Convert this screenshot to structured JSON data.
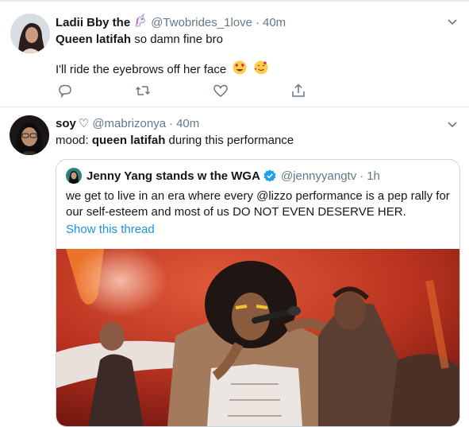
{
  "tweet1": {
    "display_name": "Ladii Bby the",
    "name_emoji": "unicorn-emoji",
    "handle": "@Twobrides_1love",
    "time": "40m",
    "line1_bold": "Queen latifah",
    "line1_rest": " so damn fine bro",
    "line2": "I'll ride the eyebrows off her face",
    "emojis": [
      "heart-eyes-emoji",
      "smiling-face-with-hearts-emoji"
    ],
    "actions": [
      "reply-icon",
      "retweet-icon",
      "like-icon",
      "share-icon"
    ]
  },
  "tweet2": {
    "display_name": "soy",
    "name_suffix": "♡",
    "handle": "@mabrizonya",
    "time": "40m",
    "text_prefix": "mood: ",
    "text_bold": "queen latifah",
    "text_rest": " during this performance"
  },
  "quoted": {
    "display_name": "Jenny Yang stands w the WGA",
    "verified": true,
    "handle": "@jennyyangtv",
    "time": "1h",
    "line1": "we get to live in an era where every @lizzo performance is a pep rally for",
    "line2": "our self-esteem and most of us DO NOT EVEN DESERVE HER.",
    "show_thread": "Show this thread"
  },
  "colors": {
    "link": "#1b95e0",
    "secondary": "#657786",
    "border": "#e6ecf0",
    "stage_red": "#c63a26"
  }
}
